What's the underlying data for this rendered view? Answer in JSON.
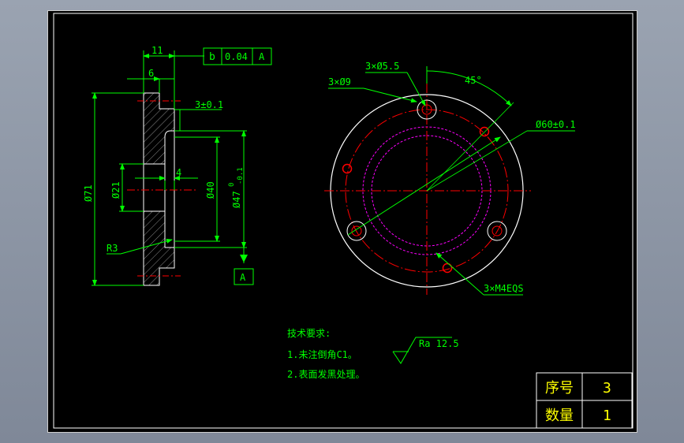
{
  "colors": {
    "background": "#000000",
    "frame": "#ffffff",
    "dimension": "#00ff00",
    "center_line": "#ff0000",
    "hidden_circle": "#ff00ff",
    "outline": "#ffffff",
    "hatch": "#8a8a8a",
    "title_text": "#ffff00",
    "note_text": "#00ff00"
  },
  "side_view": {
    "dim_11": "11",
    "dim_6": "6",
    "dim_4": "4",
    "dim_3": "3±0.1",
    "dia_71": "Ø71",
    "dia_21": "Ø21",
    "dia_40": "Ø40",
    "dia_47": "Ø47",
    "dia_47_tol_upper": "0",
    "dia_47_tol_lower": "-0.1",
    "radius": "R3",
    "datum": "A",
    "gdt": {
      "symbol": "b",
      "value": "0.04",
      "datum": "A"
    }
  },
  "front_view": {
    "callout_holes_small": "3×Ø5.5",
    "callout_holes_large": "3×Ø9",
    "angle": "45°",
    "bolt_circle": "Ø60±0.1",
    "threads": "3×M4EQS"
  },
  "notes": {
    "heading": "技术要求:",
    "line1": "1.未注倒角C1。",
    "line2": "2.表面发黑处理。",
    "roughness": "Ra 12.5"
  },
  "title_block": {
    "row1_label": "序号",
    "row1_value": "3",
    "row2_label": "数量",
    "row2_value": "1"
  }
}
